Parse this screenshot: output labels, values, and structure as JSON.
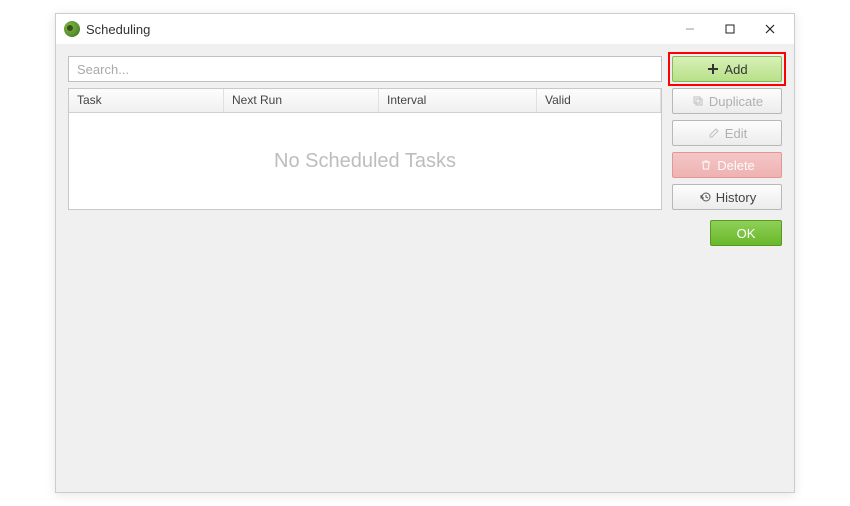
{
  "window": {
    "title": "Scheduling"
  },
  "search": {
    "placeholder": "Search..."
  },
  "table": {
    "columns": {
      "task": "Task",
      "nextRun": "Next Run",
      "interval": "Interval",
      "valid": "Valid"
    },
    "emptyMessage": "No Scheduled Tasks"
  },
  "buttons": {
    "add": "Add",
    "duplicate": "Duplicate",
    "edit": "Edit",
    "delete": "Delete",
    "history": "History",
    "ok": "OK"
  }
}
